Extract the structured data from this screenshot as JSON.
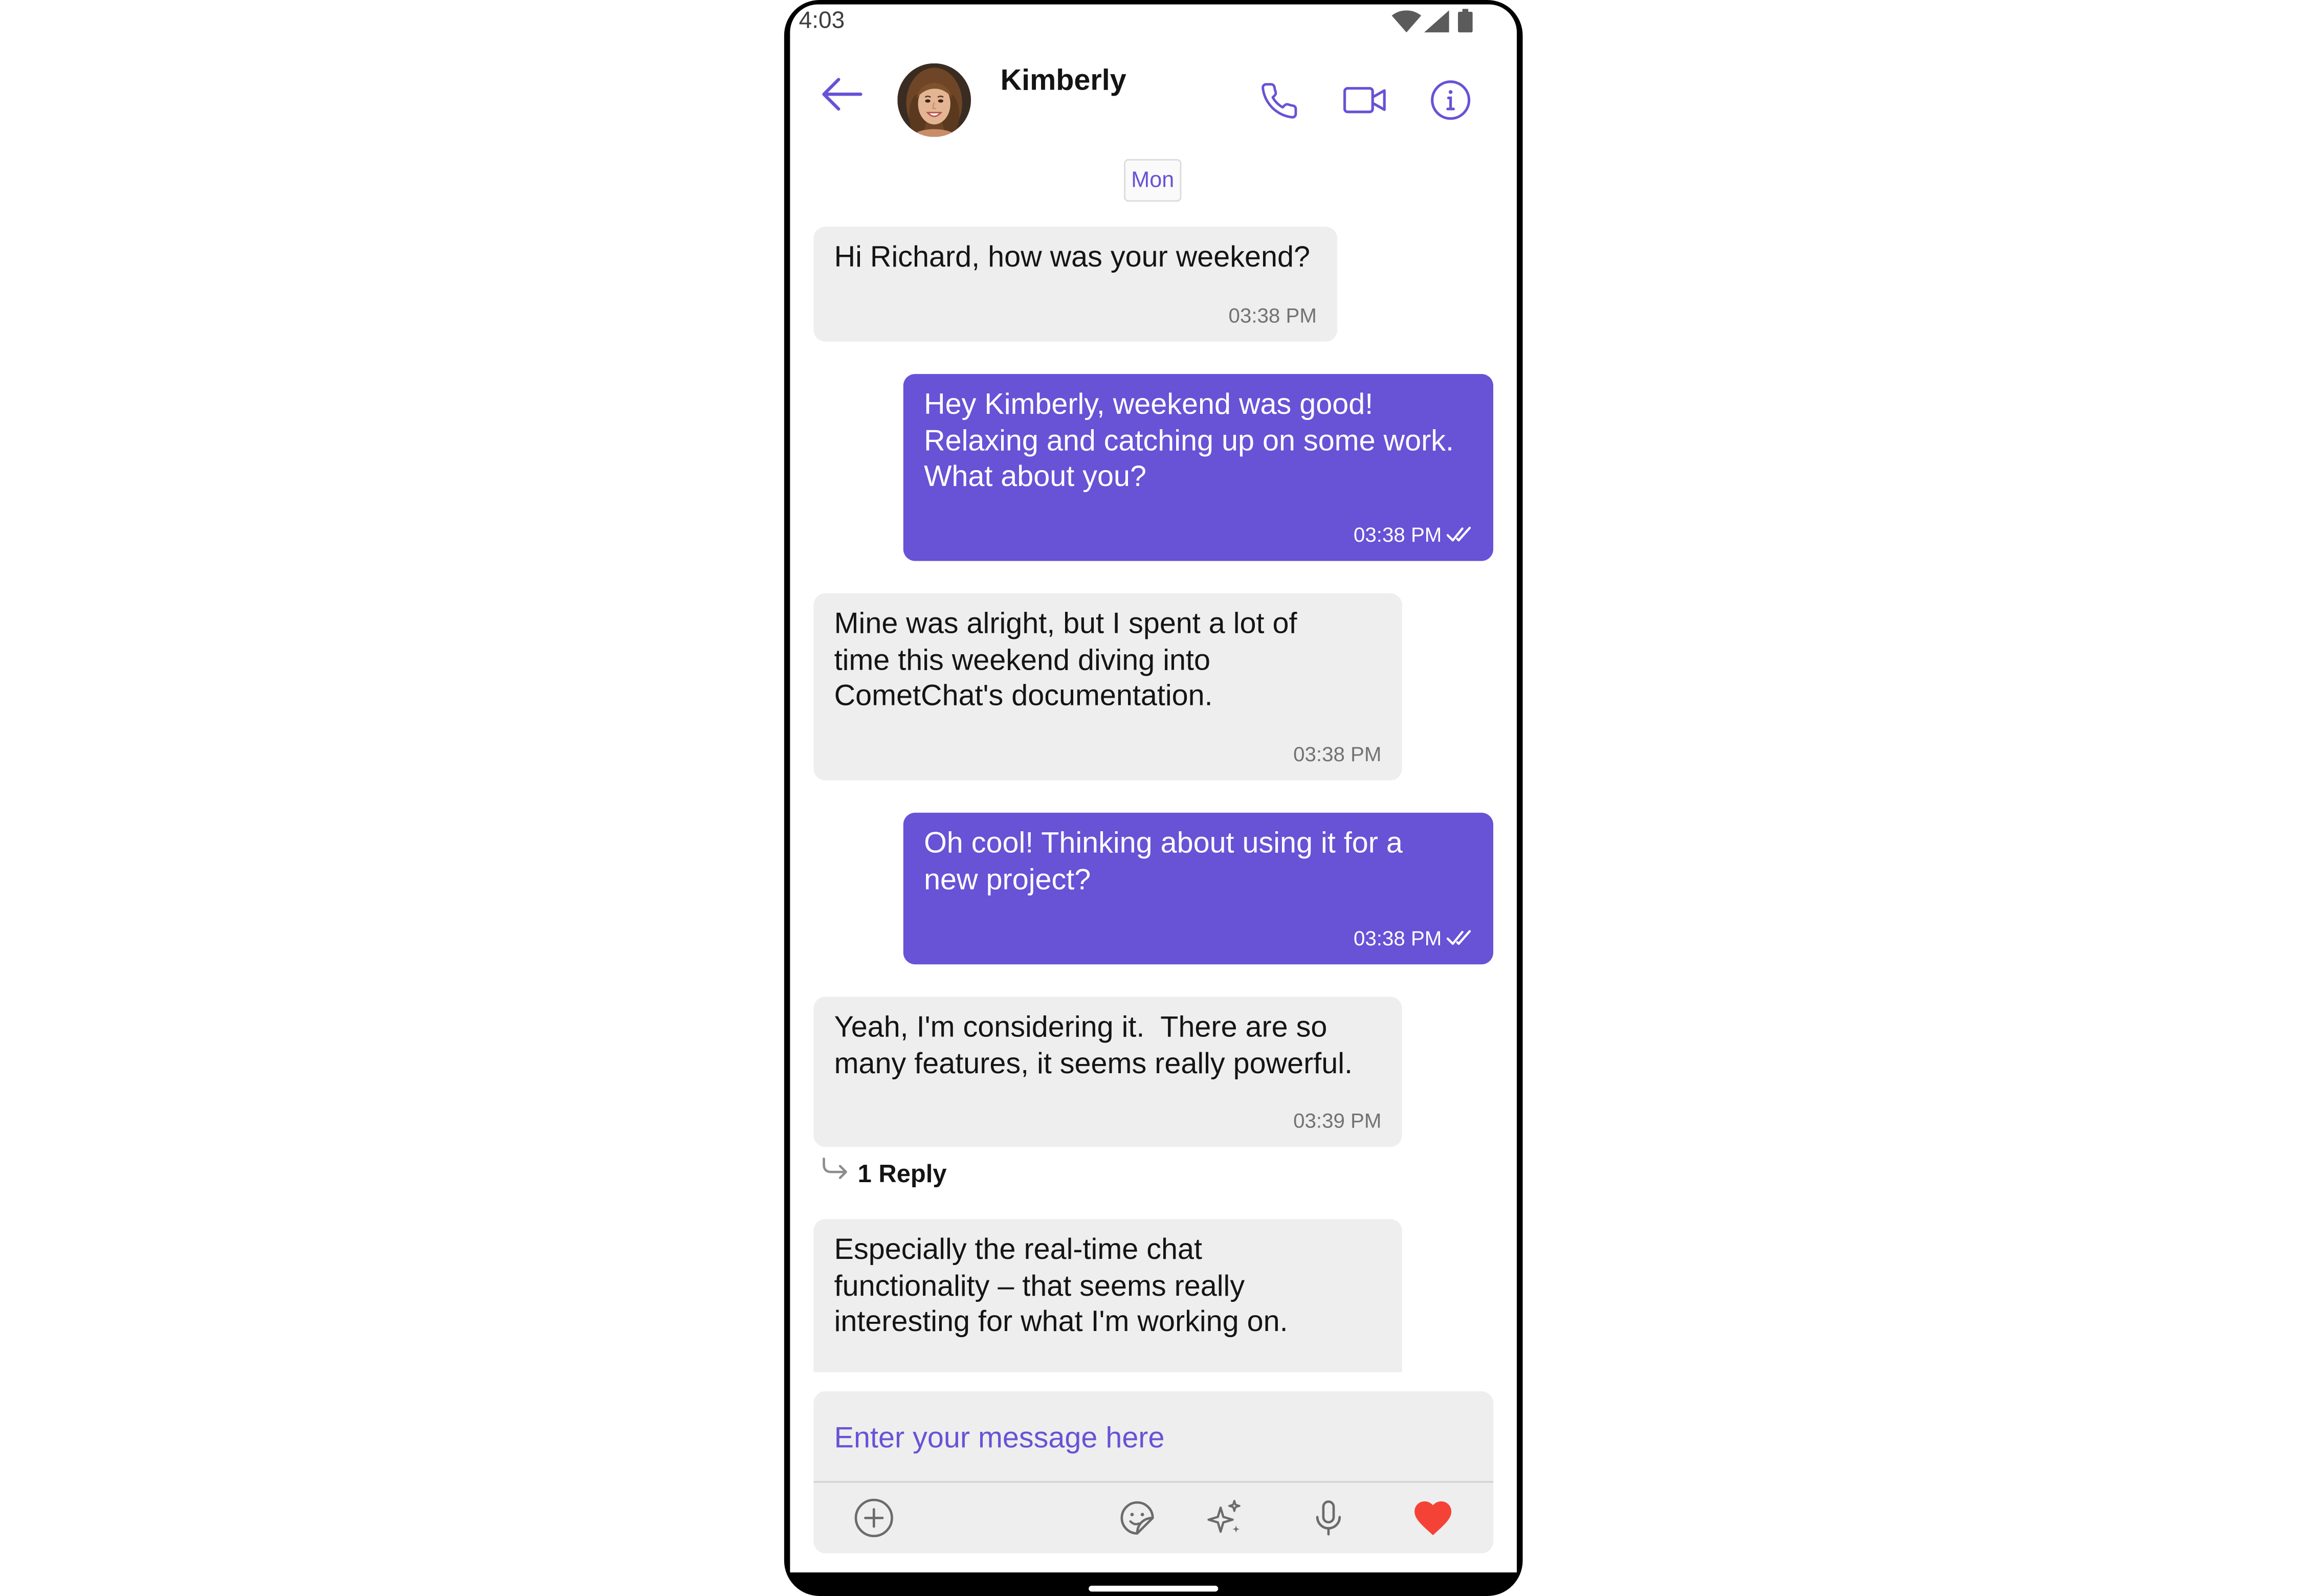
{
  "status_bar": {
    "time": "4:03",
    "icons": [
      "wifi-icon",
      "cellular-signal-icon",
      "battery-icon"
    ]
  },
  "header": {
    "back_icon": "arrow-left-icon",
    "title": "Kimberly",
    "actions": [
      {
        "icon": "phone-icon"
      },
      {
        "icon": "video-camera-icon"
      },
      {
        "icon": "info-icon"
      }
    ]
  },
  "date_separator": "Mon",
  "messages": [
    {
      "outgoing": false,
      "text": "Hi Richard, how was your weekend?",
      "time": "03:38 PM"
    },
    {
      "outgoing": true,
      "text": "Hey Kimberly, weekend was good!\nRelaxing and catching up on some work.\nWhat about you?",
      "time": "03:38 PM",
      "receipt_icon": "double-check-icon"
    },
    {
      "outgoing": false,
      "text": "Mine was alright, but I spent a lot of\ntime this weekend diving into\nCometChat's documentation.",
      "time": "03:38 PM"
    },
    {
      "outgoing": true,
      "text": "Oh cool! Thinking about using it for a\nnew project?",
      "time": "03:38 PM",
      "receipt_icon": "double-check-icon"
    },
    {
      "outgoing": false,
      "text": "Yeah, I'm considering it.  There are so\nmany features, it seems really powerful.",
      "time": "03:39 PM",
      "thread_icon": "reply-arrow-icon",
      "thread_replies": "1 Reply"
    },
    {
      "outgoing": false,
      "text": "Especially the real-time chat\nfunctionality – that seems really\ninteresting for what I'm working on."
    }
  ],
  "composer": {
    "placeholder": "Enter your message here",
    "left_actions": [
      {
        "icon": "plus-circle-icon"
      }
    ],
    "right_actions": [
      {
        "icon": "sticker-icon"
      },
      {
        "icon": "sparkles-icon"
      },
      {
        "icon": "microphone-icon"
      },
      {
        "icon": "heart-icon"
      }
    ]
  },
  "colors": {
    "primary": "#6852D6",
    "incoming_bubble": "#EEEEEE",
    "meta_text": "#727272",
    "heart": "#F44336"
  }
}
